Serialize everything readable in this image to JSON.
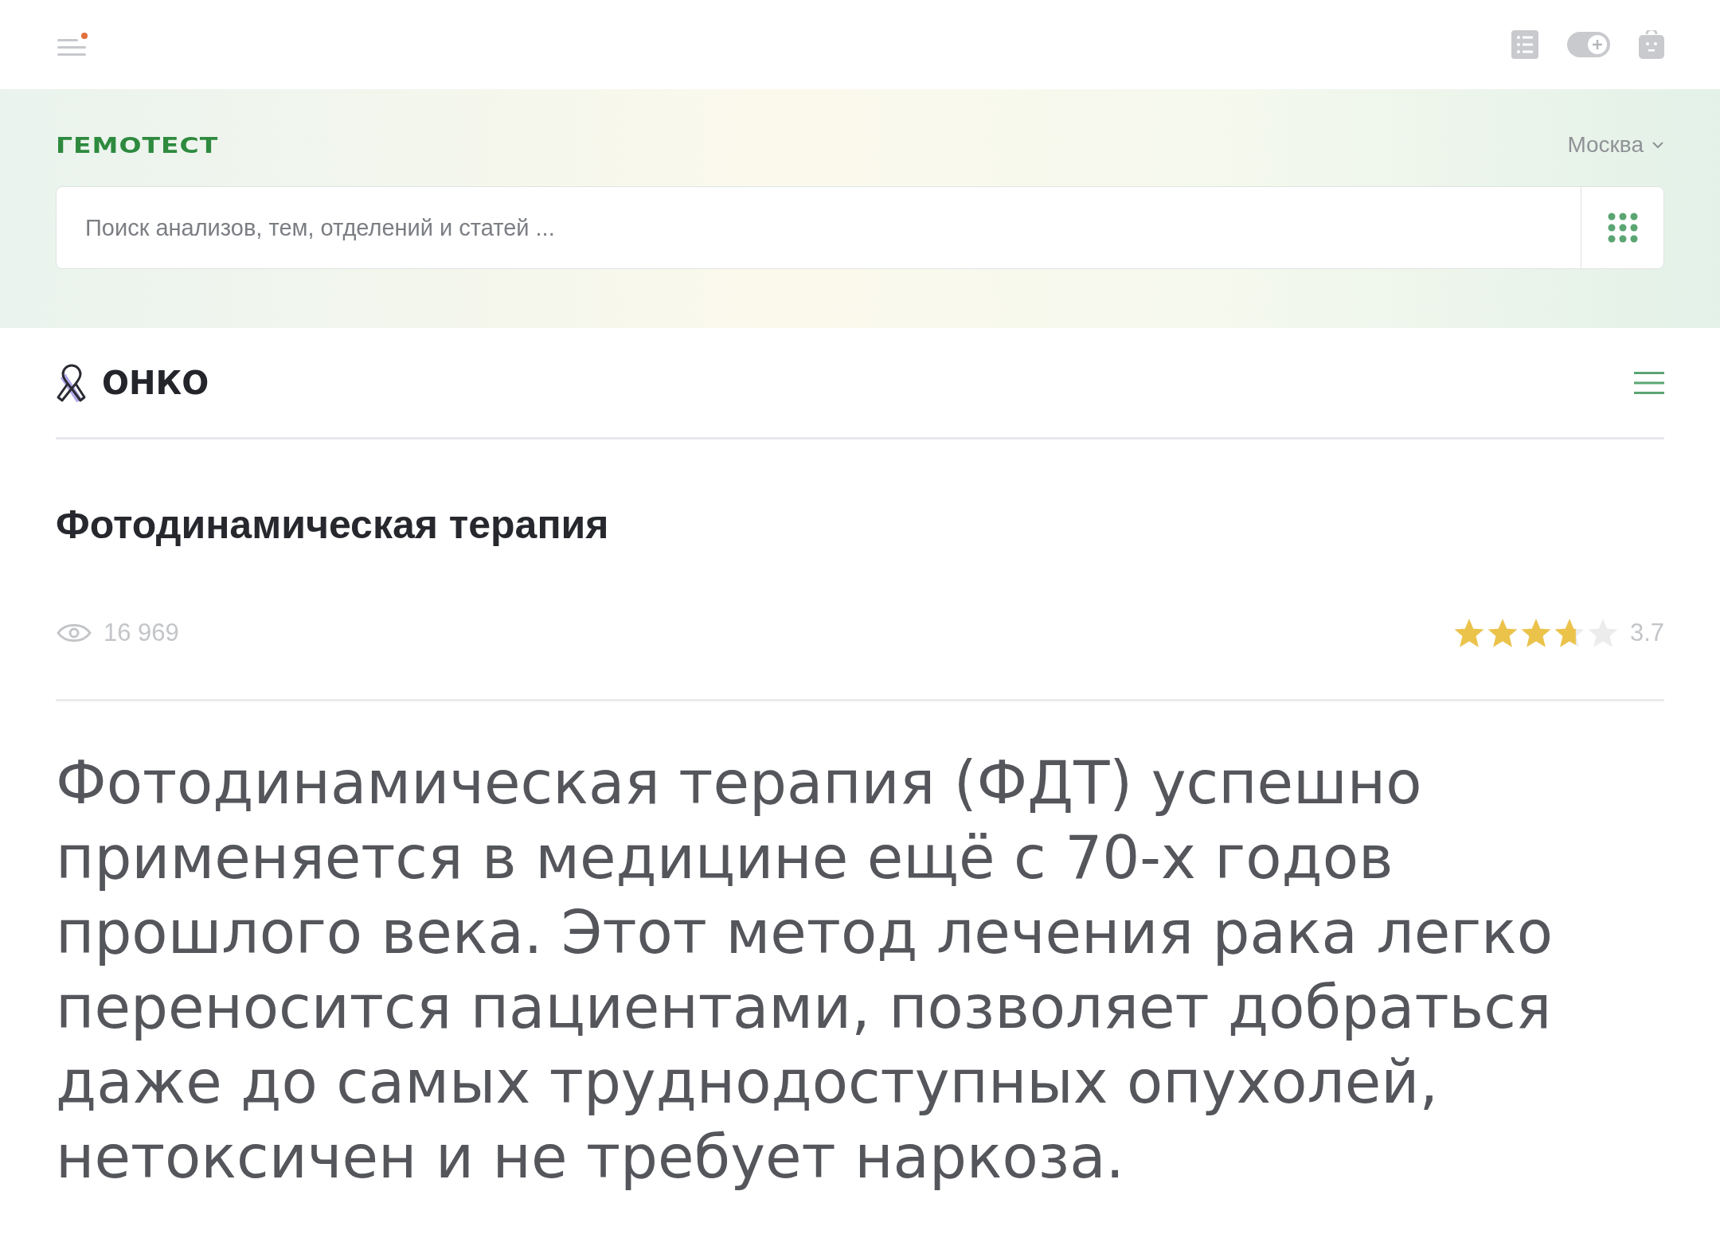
{
  "top_bar": {
    "menu_notification": true
  },
  "header": {
    "logo": "ГЕМОТЕСТ",
    "city": "Москва",
    "search": {
      "placeholder": "Поиск анализов, тем, отделений и статей ..."
    }
  },
  "section": {
    "title": "ОНКО"
  },
  "article": {
    "title": "Фотодинамическая терапия",
    "views": "16 969",
    "rating": {
      "stars": 3.7,
      "value": "3.7"
    },
    "lead": "Фотодинамическая терапия (ФДТ) успешно применяется в медицине ещё с 70-х годов прошлого века. Этот метод лечения рака легко переносится пациентами, позволяет добраться даже до самых труднодоступных опухолей, нетоксичен и не требует наркоза."
  }
}
